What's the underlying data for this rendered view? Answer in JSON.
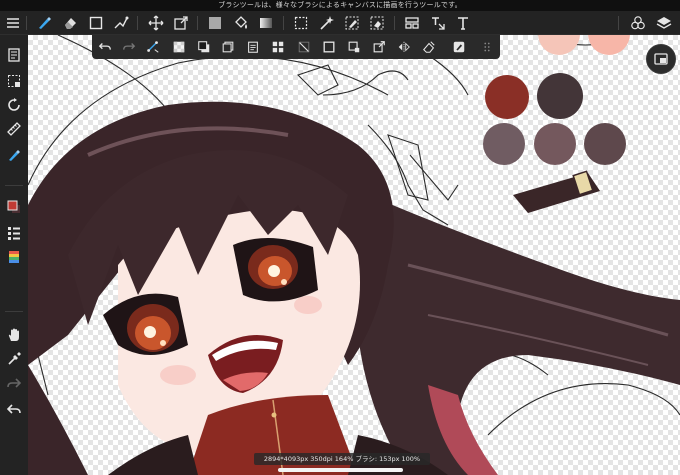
{
  "hint_text": "ブラシツールは、様々なブラシによるキャンバスに描画を行うツールです。",
  "status_text": "2894*4093px 350dpi 164% ブラシ: 153px 100%",
  "palette": {
    "colors": [
      "#8a2f26",
      "#433538",
      "#705c62",
      "#74585d",
      "#5e484c"
    ],
    "top_strip": [
      "#f5c5b8",
      "#f7b6a8"
    ]
  },
  "icons": {
    "main_toolbar": [
      "menu-icon",
      "brush-icon",
      "eraser-icon",
      "shape-icon",
      "smudge-icon",
      "move-icon",
      "transform-icon",
      "fill-color-icon",
      "bucket-icon",
      "gradient-icon",
      "lasso-select-icon",
      "magic-wand-icon",
      "select-pen-icon",
      "select-eraser-icon",
      "panel-icon",
      "text-icon-2",
      "text-icon",
      "materials-icon",
      "layers-icon"
    ],
    "sub_toolbar": [
      "undo-icon",
      "redo-icon",
      "snap-icon",
      "clear-icon",
      "fill-fg-icon",
      "copy-icon",
      "paste-icon",
      "grid-icon",
      "line-icon",
      "frame-icon",
      "canvas-size-icon",
      "export-icon",
      "flip-icon",
      "eraser-layer-icon",
      "more-icon"
    ],
    "left_sidebar": [
      "edit-icon",
      "select-all-icon",
      "rotate-icon",
      "ruler-icon",
      "brush-tool-icon",
      "color-icon",
      "layer-list-icon",
      "palette-icon",
      "hand-icon",
      "eyedropper-icon",
      "redo-side-icon",
      "undo-side-icon"
    ]
  }
}
